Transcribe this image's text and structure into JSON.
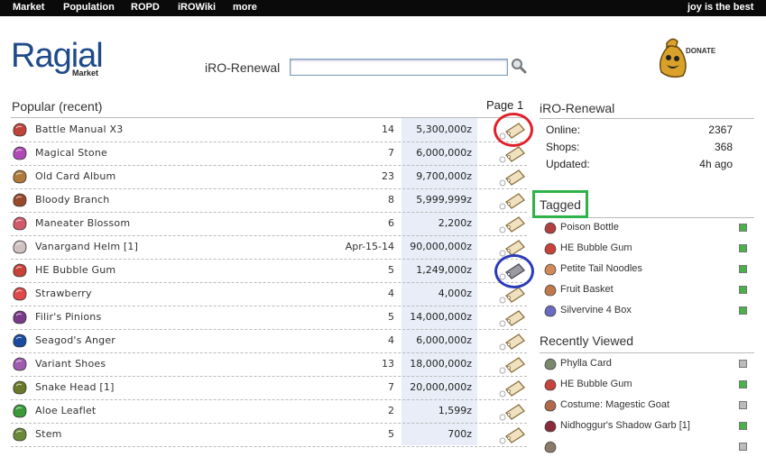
{
  "topbar": {
    "nav": [
      "Market",
      "Population",
      "ROPD",
      "iROWiki",
      "more"
    ],
    "user": "joy is the best"
  },
  "header": {
    "logo": "Ragial",
    "logo_sub": "Market",
    "server": "iRO-Renewal",
    "search": {
      "value": "",
      "placeholder": ""
    },
    "donate_label": "DONATE"
  },
  "popular": {
    "title": "Popular (recent)",
    "page": "Page 1",
    "items": [
      {
        "name": "Battle Manual X3",
        "qty": "14",
        "price": "5,300,000z",
        "icon": "book-icon",
        "color": "#c0443a"
      },
      {
        "name": "Magical Stone",
        "qty": "7",
        "price": "6,000,000z",
        "icon": "crystal-icon",
        "color": "#b04ab8"
      },
      {
        "name": "Old Card Album",
        "qty": "23",
        "price": "9,700,000z",
        "icon": "album-icon",
        "color": "#b07a3a"
      },
      {
        "name": "Bloody Branch",
        "qty": "8",
        "price": "5,999,999z",
        "icon": "branch-icon",
        "color": "#9a4a2a"
      },
      {
        "name": "Maneater Blossom",
        "qty": "6",
        "price": "2,200z",
        "icon": "blossom-icon",
        "color": "#d05a6a"
      },
      {
        "name": "Vanargand Helm [1]",
        "qty": "Apr-15-14",
        "price": "90,000,000z",
        "icon": "helm-icon",
        "color": "#d0c0c0"
      },
      {
        "name": "HE Bubble Gum",
        "qty": "5",
        "price": "1,249,000z",
        "icon": "gum-icon",
        "color": "#c8423a"
      },
      {
        "name": "Strawberry",
        "qty": "4",
        "price": "4,000z",
        "icon": "strawberry-icon",
        "color": "#e04a4a"
      },
      {
        "name": "Filir's Pinions",
        "qty": "5",
        "price": "14,000,000z",
        "icon": "wing-icon",
        "color": "#7a3a8a"
      },
      {
        "name": "Seagod's Anger",
        "qty": "4",
        "price": "6,000,000z",
        "icon": "orb-icon",
        "color": "#1a4aa0"
      },
      {
        "name": "Variant Shoes",
        "qty": "13",
        "price": "18,000,000z",
        "icon": "shoes-icon",
        "color": "#a05ab0"
      },
      {
        "name": "Snake Head [1]",
        "qty": "7",
        "price": "20,000,000z",
        "icon": "snake-icon",
        "color": "#6a7a2a"
      },
      {
        "name": "Aloe Leaflet",
        "qty": "2",
        "price": "1,599z",
        "icon": "leaf-icon",
        "color": "#3a9a3a"
      },
      {
        "name": "Stem",
        "qty": "5",
        "price": "700z",
        "icon": "stem-icon",
        "color": "#6a8a3a"
      }
    ]
  },
  "server_panel": {
    "title": "iRO-Renewal",
    "stats": [
      {
        "label": "Online:",
        "value": "2367"
      },
      {
        "label": "Shops:",
        "value": "368"
      },
      {
        "label": "Updated:",
        "value": "4h ago"
      }
    ]
  },
  "tagged": {
    "title": "Tagged",
    "items": [
      {
        "name": "Poison Bottle",
        "icon": "potion-icon",
        "color": "#b04040",
        "mark": "#4ab04a"
      },
      {
        "name": "HE Bubble Gum",
        "icon": "gum-icon",
        "color": "#c8423a",
        "mark": "#4ab04a"
      },
      {
        "name": "Petite Tail Noodles",
        "icon": "noodles-icon",
        "color": "#d08a5a",
        "mark": "#4ab04a"
      },
      {
        "name": "Fruit Basket",
        "icon": "basket-icon",
        "color": "#c07a4a",
        "mark": "#4ab04a"
      },
      {
        "name": "Silvervine 4 Box",
        "icon": "box-icon",
        "color": "#6a6ac0",
        "mark": "#4ab04a"
      }
    ]
  },
  "recent": {
    "title": "Recently Viewed",
    "items": [
      {
        "name": "Phylla Card",
        "icon": "card-icon",
        "color": "#7a8a6a",
        "mark": "#bbbbbb"
      },
      {
        "name": "HE Bubble Gum",
        "icon": "gum-icon",
        "color": "#c8423a",
        "mark": "#4ab04a"
      },
      {
        "name": "Costume: Magestic Goat",
        "icon": "goat-icon",
        "color": "#b06a4a",
        "mark": "#bbbbbb"
      },
      {
        "name": "Nidhoggur's Shadow Garb [1]",
        "icon": "garb-icon",
        "color": "#8a2a3a",
        "mark": "#4ab04a"
      },
      {
        "name": "",
        "icon": "item-icon",
        "color": "#8a7a6a",
        "mark": "#bbbbbb"
      }
    ]
  },
  "colors": {
    "accent": "#1f4a8a",
    "red_circle": "#e0202a",
    "blue_circle": "#2a3ab8",
    "green_box": "#2fb24a"
  }
}
